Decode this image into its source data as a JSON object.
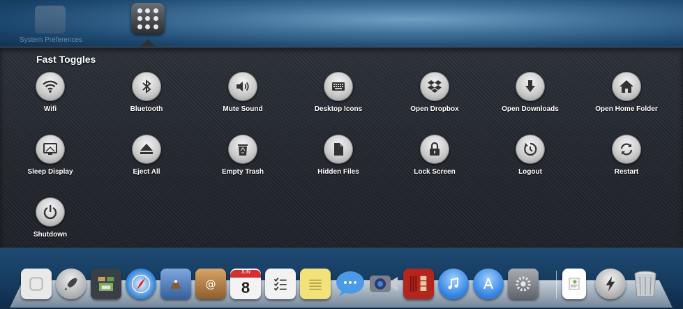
{
  "desktop": {
    "sysprefs_label": "System Preferences"
  },
  "panel": {
    "title": "Fast Toggles",
    "toggles": [
      {
        "label": "Wifi",
        "icon": "wifi-icon"
      },
      {
        "label": "Bluetooth",
        "icon": "bluetooth-icon"
      },
      {
        "label": "Mute Sound",
        "icon": "speaker-icon"
      },
      {
        "label": "Desktop Icons",
        "icon": "keyboard-icon"
      },
      {
        "label": "Open Dropbox",
        "icon": "dropbox-icon"
      },
      {
        "label": "Open Downloads",
        "icon": "download-arrow-icon"
      },
      {
        "label": "Open Home Folder",
        "icon": "home-icon"
      },
      {
        "label": "Sleep Display",
        "icon": "display-icon"
      },
      {
        "label": "Eject All",
        "icon": "eject-icon"
      },
      {
        "label": "Empty Trash",
        "icon": "recycle-trash-icon"
      },
      {
        "label": "Hidden Files",
        "icon": "hidden-file-icon"
      },
      {
        "label": "Lock Screen",
        "icon": "padlock-icon"
      },
      {
        "label": "Logout",
        "icon": "logout-icon"
      },
      {
        "label": "Restart",
        "icon": "restart-icon"
      },
      {
        "label": "Shutdown",
        "icon": "power-icon"
      }
    ]
  },
  "dock": {
    "calendar_month": "JUN",
    "calendar_day": "8",
    "items": [
      {
        "icon": "finder-icon",
        "color": "#e9e9e9"
      },
      {
        "icon": "launchpad-rocket-icon",
        "color": "#b8bcc2"
      },
      {
        "icon": "mission-control-icon",
        "color": "#3a3f47"
      },
      {
        "icon": "safari-compass-icon",
        "color": "#2d7fd6"
      },
      {
        "icon": "mail-stamp-icon",
        "color": "#4f7fc4"
      },
      {
        "icon": "contacts-book-icon",
        "color": "#b98548"
      },
      {
        "icon": "calendar-icon",
        "color": "#f3f3f3"
      },
      {
        "icon": "reminders-icon",
        "color": "#f2f2f2"
      },
      {
        "icon": "notes-icon",
        "color": "#f3e27a"
      },
      {
        "icon": "messages-bubble-icon",
        "color": "#4a9ae6"
      },
      {
        "icon": "facetime-camera-icon",
        "color": "#7a7f88"
      },
      {
        "icon": "photo-booth-icon",
        "color": "#b3261e"
      },
      {
        "icon": "itunes-icon",
        "color": "#2d7fe0"
      },
      {
        "icon": "app-store-icon",
        "color": "#2d7fe0"
      },
      {
        "icon": "system-preferences-gear-icon",
        "color": "#8a8f96"
      },
      {
        "icon": "document-preview-icon",
        "color": "#ffffff"
      },
      {
        "icon": "fast-toggles-bolt-icon",
        "color": "#c6c8cc"
      },
      {
        "icon": "trash-can-icon",
        "color": "#c9ccd1"
      }
    ]
  }
}
